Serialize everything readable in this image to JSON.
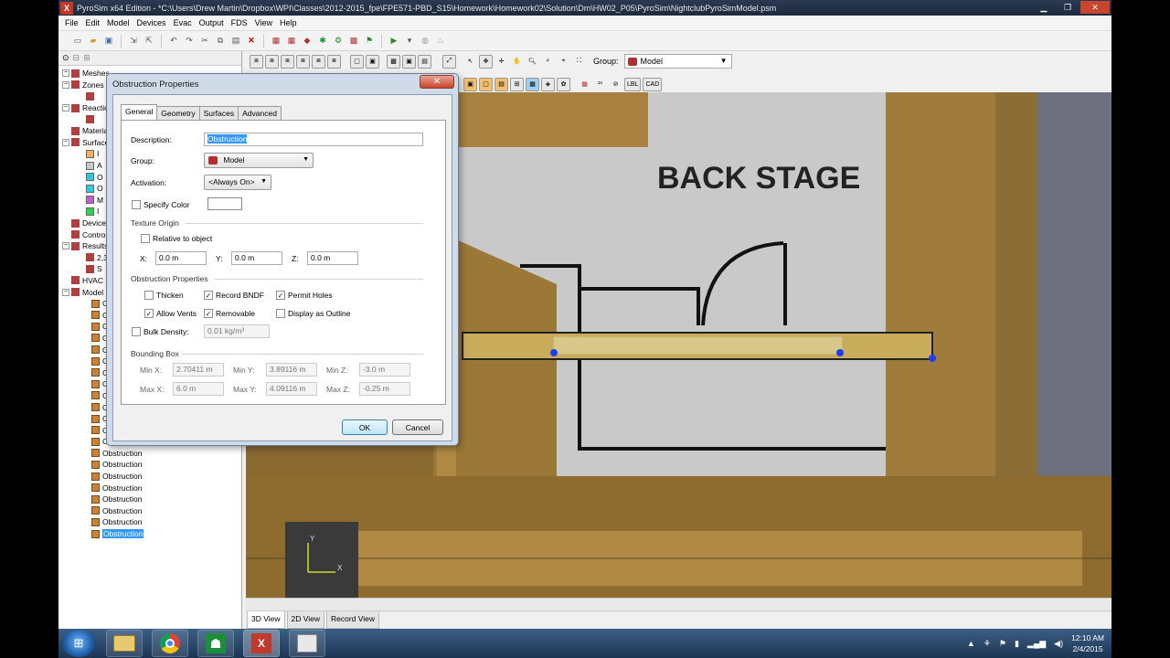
{
  "window": {
    "title": "PyroSim x64 Edition - *C:\\Users\\Drew Martin\\Dropbox\\WPI\\Classes\\2012-2015_fpe\\FPE571-PBD_S15\\Homework\\Homework02\\Solution\\Dm\\HW02_P05\\PyroSim\\NightclubPyroSimModel.psm",
    "logo": "X"
  },
  "menu": [
    "File",
    "Edit",
    "Model",
    "Devices",
    "Evac",
    "Output",
    "FDS",
    "View",
    "Help"
  ],
  "tree": {
    "items": [
      {
        "label": "Meshes",
        "icon": "mesh-icon"
      },
      {
        "label": "Zones",
        "icon": "zone-icon"
      },
      {
        "label": "",
        "icon": "zone-sub-icon"
      },
      {
        "label": "Reactions",
        "icon": "reaction-icon"
      },
      {
        "label": "",
        "icon": "reaction-sub-icon"
      },
      {
        "label": "Materials",
        "icon": "material-icon"
      },
      {
        "label": "Surfaces",
        "icon": "surface-icon"
      },
      {
        "label": "I",
        "icon": "surface-color-orange"
      },
      {
        "label": "A",
        "icon": "surface-color-gray"
      },
      {
        "label": "O",
        "icon": "surface-color-cyan"
      },
      {
        "label": "O",
        "icon": "surface-color-cyan"
      },
      {
        "label": "M",
        "icon": "surface-color-purple"
      },
      {
        "label": "I",
        "icon": "surface-color-green"
      },
      {
        "label": "Devices",
        "icon": "device-icon"
      },
      {
        "label": "Controls",
        "icon": "control-icon"
      },
      {
        "label": "Results",
        "icon": "result-icon"
      },
      {
        "label": "2,3",
        "icon": "plot3d-icon"
      },
      {
        "label": "S",
        "icon": "slice-icon"
      },
      {
        "label": "HVAC",
        "icon": "hvac-icon"
      },
      {
        "label": "Model",
        "icon": "model-icon"
      }
    ],
    "obstructions": [
      "Obstruction",
      "Obstruction",
      "Obstruction",
      "Obstruction",
      "Obstruction",
      "Obstruction",
      "Obstruction",
      "Obstruction",
      "Obstruction",
      "Obstruction",
      "Obstruction",
      "Obstruction",
      "Obstruction",
      "Obstruction",
      "Obstruction",
      "Obstruction",
      "Obstruction",
      "Obstruction",
      "Obstruction",
      "Obstruction",
      "Obstruction"
    ],
    "selected_label": "Obstruction"
  },
  "view_toolbar": {
    "group_label": "Group:",
    "group_value": "Model",
    "lbl": "LBL",
    "cad": "CAD"
  },
  "scene": {
    "room_label": "BACK STAGE",
    "axis_y": "Y",
    "axis_x": "X"
  },
  "view_tabs": [
    "3D View",
    "2D View",
    "Record View"
  ],
  "dialog": {
    "title": "Obstruction Properties",
    "close_glyph": "✕",
    "tabs": [
      "General",
      "Geometry",
      "Surfaces",
      "Advanced"
    ],
    "description_label": "Description:",
    "description_value": "Obstruction",
    "group_label": "Group:",
    "group_value": "Model",
    "activation_label": "Activation:",
    "activation_value": "<Always On>",
    "specify_color_label": "Specify Color",
    "texture_origin_label": "Texture Origin",
    "relative_label": "Relative to object",
    "x_label": "X:",
    "x_value": "0.0 m",
    "y_label": "Y:",
    "y_value": "0.0 m",
    "z_label": "Z:",
    "z_value": "0.0 m",
    "obstruction_props_label": "Obstruction Properties",
    "thicken_label": "Thicken",
    "record_bndf_label": "Record BNDF",
    "permit_holes_label": "Permit Holes",
    "allow_vents_label": "Allow Vents",
    "removable_label": "Removable",
    "display_outline_label": "Display as Outline",
    "bulk_density_label": "Bulk Density:",
    "bulk_density_value": "0.01 kg/m³",
    "bounding_box_label": "Bounding Box",
    "minx_label": "Min X:",
    "minx_value": "2.70411 m",
    "miny_label": "Min Y:",
    "miny_value": "3.89116 m",
    "minz_label": "Min Z:",
    "minz_value": "-3.0 m",
    "maxx_label": "Max X:",
    "maxx_value": "6.0 m",
    "maxy_label": "Max Y:",
    "maxy_value": "4.09116 m",
    "maxz_label": "Max Z:",
    "maxz_value": "-0.25 m",
    "ok_label": "OK",
    "cancel_label": "Cancel"
  },
  "taskbar": {
    "start_glyph": "⊞",
    "items": [
      "file-explorer-icon",
      "chrome-icon",
      "pathfinder-icon",
      "pyrosim-icon",
      "blank-app-icon"
    ],
    "time": "12:10 AM",
    "date": "2/4/2015"
  }
}
